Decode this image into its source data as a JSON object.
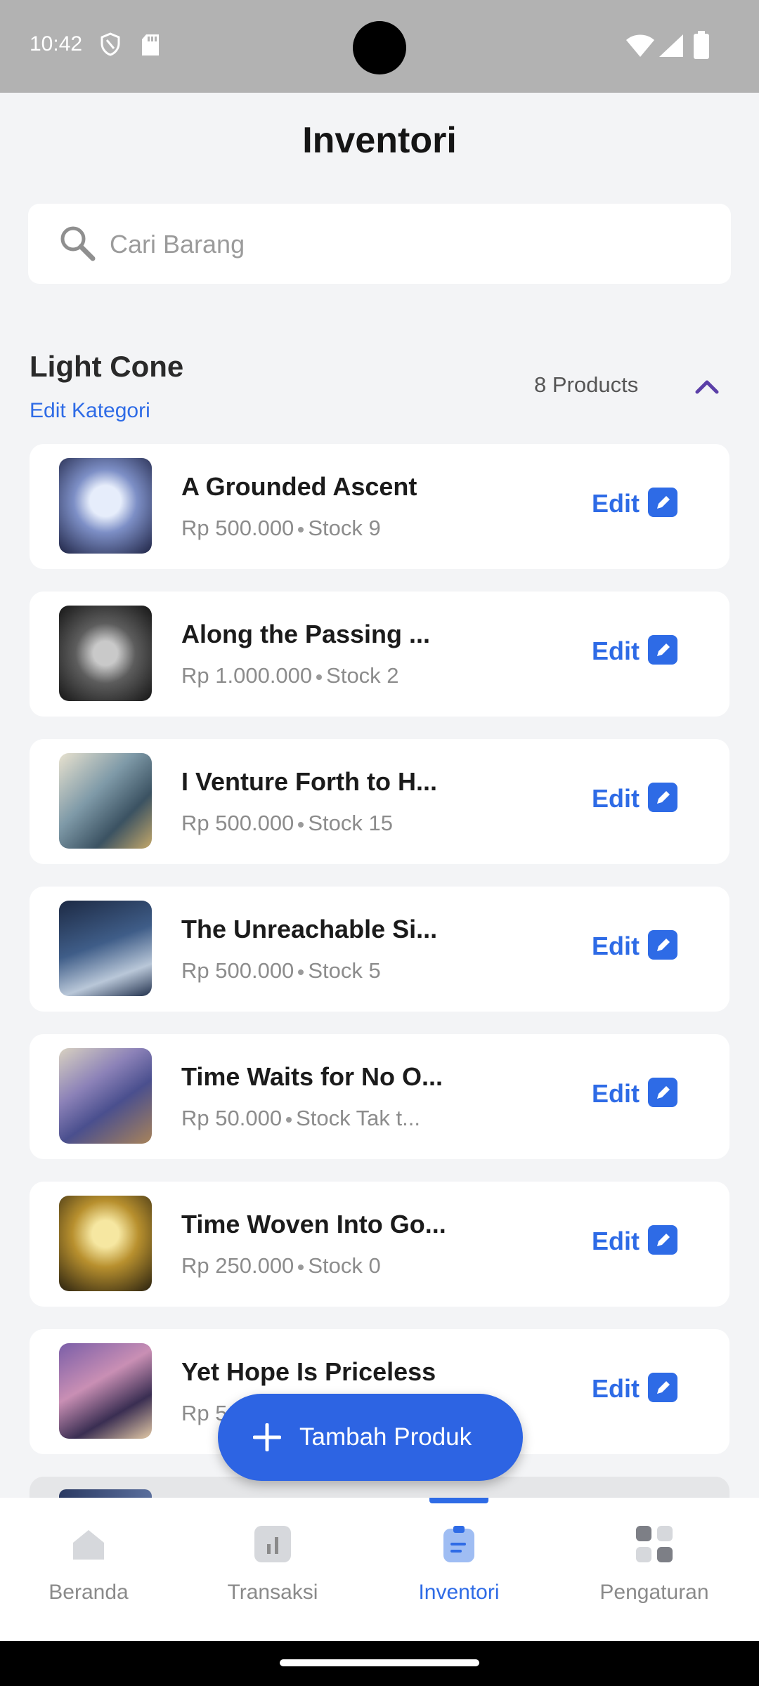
{
  "status_bar": {
    "time": "10:42"
  },
  "header": {
    "title": "Inventori"
  },
  "search": {
    "placeholder": "Cari Barang"
  },
  "category": {
    "name": "Light Cone",
    "edit_label": "Edit Kategori",
    "count_label": "8 Products"
  },
  "products": [
    {
      "name": "A Grounded Ascent",
      "price": "Rp 500.000",
      "stock": "Stock 9",
      "edit": "Edit"
    },
    {
      "name": "Along the Passing ...",
      "price": "Rp 1.000.000",
      "stock": "Stock 2",
      "edit": "Edit"
    },
    {
      "name": "I Venture Forth to H...",
      "price": "Rp 500.000",
      "stock": "Stock 15",
      "edit": "Edit"
    },
    {
      "name": "The Unreachable Si...",
      "price": "Rp 500.000",
      "stock": "Stock 5",
      "edit": "Edit"
    },
    {
      "name": "Time Waits for No O...",
      "price": "Rp 50.000",
      "stock": "Stock Tak t...",
      "edit": "Edit"
    },
    {
      "name": "Time Woven Into Go...",
      "price": "Rp 250.000",
      "stock": "Stock 0",
      "edit": "Edit"
    },
    {
      "name": "Yet Hope Is Priceless",
      "price": "Rp 5",
      "stock": "",
      "edit": "Edit"
    }
  ],
  "fab": {
    "label": "Tambah Produk"
  },
  "bottom_nav": [
    {
      "label": "Beranda",
      "active": false
    },
    {
      "label": "Transaksi",
      "active": false
    },
    {
      "label": "Inventori",
      "active": true
    },
    {
      "label": "Pengaturan",
      "active": false
    }
  ],
  "colors": {
    "accent": "#2e6be6",
    "background": "#f3f4f6",
    "status_bar": "#b2b2b2"
  }
}
